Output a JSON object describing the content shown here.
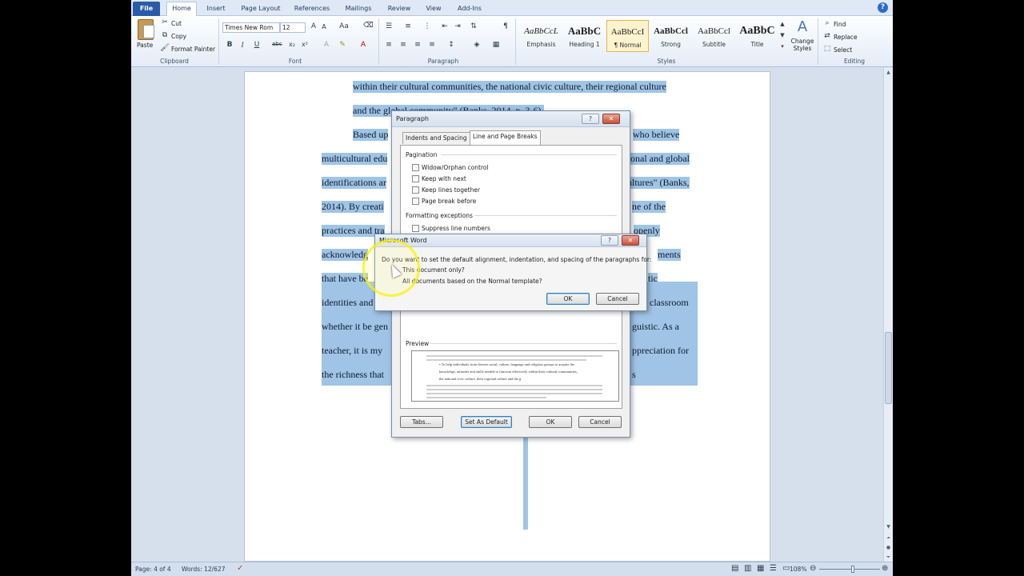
{
  "tabs": [
    "File",
    "Home",
    "Insert",
    "Page Layout",
    "References",
    "Mailings",
    "Review",
    "View",
    "Add-Ins"
  ],
  "clipboard": {
    "paste": "Paste",
    "cut": "Cut",
    "copy": "Copy",
    "format_painter": "Format Painter",
    "label": "Clipboard"
  },
  "font": {
    "name": "Times New Rom",
    "size": "12",
    "label": "Font"
  },
  "paragraph_group_label": "Paragraph",
  "styles": {
    "label": "Styles",
    "items": [
      {
        "sample": "AaBbCcL",
        "name": "Emphasis"
      },
      {
        "sample": "AaBbC",
        "name": "Heading 1"
      },
      {
        "sample": "AaBbCcI",
        "name": "¶ Normal"
      },
      {
        "sample": "AaBbCcl",
        "name": "Strong"
      },
      {
        "sample": "AaBbCcl",
        "name": "Subtitle"
      },
      {
        "sample": "AaBbC",
        "name": "Title"
      }
    ],
    "change_styles": "Change Styles"
  },
  "editing": {
    "find": "Find",
    "replace": "Replace",
    "select": "Select",
    "label": "Editing"
  },
  "document": {
    "lines": [
      "within their cultural communities, the national civic culture, their regional culture",
      "and the global community\" (Banks, 2014, p. 3-6).",
      "Based up",
      "who believe",
      "multicultural edu",
      "onal and global",
      "identifications ar",
      "ultures\" (Banks,",
      "2014).  By creati",
      "ne of the",
      "practices and tra",
      "openly",
      "acknowledg",
      "ments",
      "that have be",
      "tic",
      "identities and",
      "classroom",
      "whether it be gen",
      "guistic.  As a",
      "teacher, it is my",
      "ppreciation for",
      "the richness that",
      "s"
    ]
  },
  "paragraph_dialog": {
    "title": "Paragraph",
    "tabs": [
      "Indents and Spacing",
      "Line and Page Breaks"
    ],
    "pagination_label": "Pagination",
    "options": [
      "Widow/Orphan control",
      "Keep with next",
      "Keep lines together",
      "Page break before"
    ],
    "formatting_label": "Formatting exceptions",
    "suppress": "Suppress line numbers",
    "preview_label": "Preview",
    "preview_sample": [
      "• To help individuals from diverse racial, culture, language and religious groups to acquire the",
      "knowledge, attitudes and skills needed to function effectively within their cultural communities,",
      "the national civic culture, their regional culture and the g"
    ],
    "buttons": {
      "tabs": "Tabs...",
      "set_default": "Set As Default",
      "ok": "OK",
      "cancel": "Cancel"
    }
  },
  "msword_dialog": {
    "title": "Microsoft Word",
    "question": "Do you want to set the default alignment, indentation, and spacing of the paragraphs for:",
    "option1": "This document only?",
    "option2": "All documents based on the Normal template?",
    "ok": "OK",
    "cancel": "Cancel"
  },
  "status": {
    "page": "Page: 4 of 4",
    "words": "Words: 12/627",
    "zoom": "108%"
  }
}
